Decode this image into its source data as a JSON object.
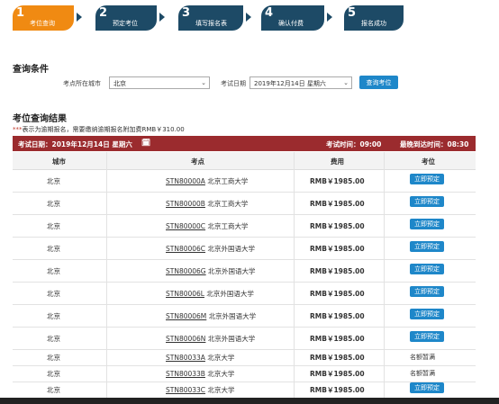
{
  "steps": [
    {
      "num": "1",
      "label": "考位查询",
      "active": true
    },
    {
      "num": "2",
      "label": "预定考位",
      "active": false
    },
    {
      "num": "3",
      "label": "填写报名表",
      "active": false
    },
    {
      "num": "4",
      "label": "确认付费",
      "active": false
    },
    {
      "num": "5",
      "label": "报名成功",
      "active": false
    }
  ],
  "search": {
    "title": "查询条件",
    "city_label": "考点所在城市",
    "city_value": "北京",
    "date_label": "考试日期",
    "date_value": "2019年12月14日 星期六",
    "button": "查询考位"
  },
  "results": {
    "title": "考位查询结果",
    "note_star": "***",
    "note": "表示为逾期报名，需要缴纳逾期报名附加费RMB￥310.00",
    "header_date": "考试日期：2019年12月14日 星期六",
    "header_time": "考试时间：09:00",
    "header_latest": "最晚到达时间：08:30",
    "columns": [
      "城市",
      "考点",
      "费用",
      "考位"
    ],
    "rows": [
      {
        "city": "北京",
        "code": "STN80000A",
        "name": "北京工商大学",
        "fee": "RMB￥1985.00",
        "action": "立即预定",
        "available": true
      },
      {
        "city": "北京",
        "code": "STN80000B",
        "name": "北京工商大学",
        "fee": "RMB￥1985.00",
        "action": "立即预定",
        "available": true
      },
      {
        "city": "北京",
        "code": "STN80000C",
        "name": "北京工商大学",
        "fee": "RMB￥1985.00",
        "action": "立即预定",
        "available": true
      },
      {
        "city": "北京",
        "code": "STN80006C",
        "name": "北京外国语大学",
        "fee": "RMB￥1985.00",
        "action": "立即预定",
        "available": true
      },
      {
        "city": "北京",
        "code": "STN80006G",
        "name": "北京外国语大学",
        "fee": "RMB￥1985.00",
        "action": "立即预定",
        "available": true
      },
      {
        "city": "北京",
        "code": "STN80006L",
        "name": "北京外国语大学",
        "fee": "RMB￥1985.00",
        "action": "立即预定",
        "available": true
      },
      {
        "city": "北京",
        "code": "STN80006M",
        "name": "北京外国语大学",
        "fee": "RMB￥1985.00",
        "action": "立即预定",
        "available": true
      },
      {
        "city": "北京",
        "code": "STN80006N",
        "name": "北京外国语大学",
        "fee": "RMB￥1985.00",
        "action": "立即预定",
        "available": true
      },
      {
        "city": "北京",
        "code": "STN80033A",
        "name": "北京大学",
        "fee": "RMB￥1985.00",
        "action": "名额暂满",
        "available": false
      },
      {
        "city": "北京",
        "code": "STN80033B",
        "name": "北京大学",
        "fee": "RMB￥1985.00",
        "action": "名额暂满",
        "available": false
      },
      {
        "city": "北京",
        "code": "STN80033C",
        "name": "北京大学",
        "fee": "RMB￥1985.00",
        "action": "立即预定",
        "available": true
      }
    ]
  }
}
